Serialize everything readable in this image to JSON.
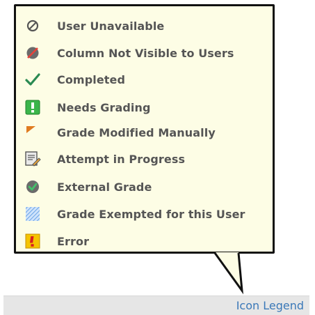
{
  "legend": {
    "items": [
      {
        "label": "User Unavailable",
        "icon": "user-unavailable-icon"
      },
      {
        "label": "Column Not Visible to Users",
        "icon": "column-hidden-icon"
      },
      {
        "label": "Completed",
        "icon": "checkmark-icon"
      },
      {
        "label": "Needs Grading",
        "icon": "needs-grading-icon"
      },
      {
        "label": "Grade Modified Manually",
        "icon": "grade-modified-flag-icon"
      },
      {
        "label": "Attempt in Progress",
        "icon": "attempt-in-progress-icon"
      },
      {
        "label": "External Grade",
        "icon": "external-grade-icon"
      },
      {
        "label": "Grade Exempted for this User",
        "icon": "grade-exempted-icon"
      },
      {
        "label": "Error",
        "icon": "error-icon"
      }
    ]
  },
  "footer": {
    "link_label": "Icon Legend"
  },
  "colors": {
    "tooltip_bg": "#fdfde5",
    "label_text": "#555555",
    "link": "#3a78b8",
    "check_green": "#2a8a52",
    "needs_grading_green": "#3bb54a",
    "flag_orange": "#e07b20",
    "error_yellow": "#f5c400",
    "error_red": "#d81f1f"
  }
}
